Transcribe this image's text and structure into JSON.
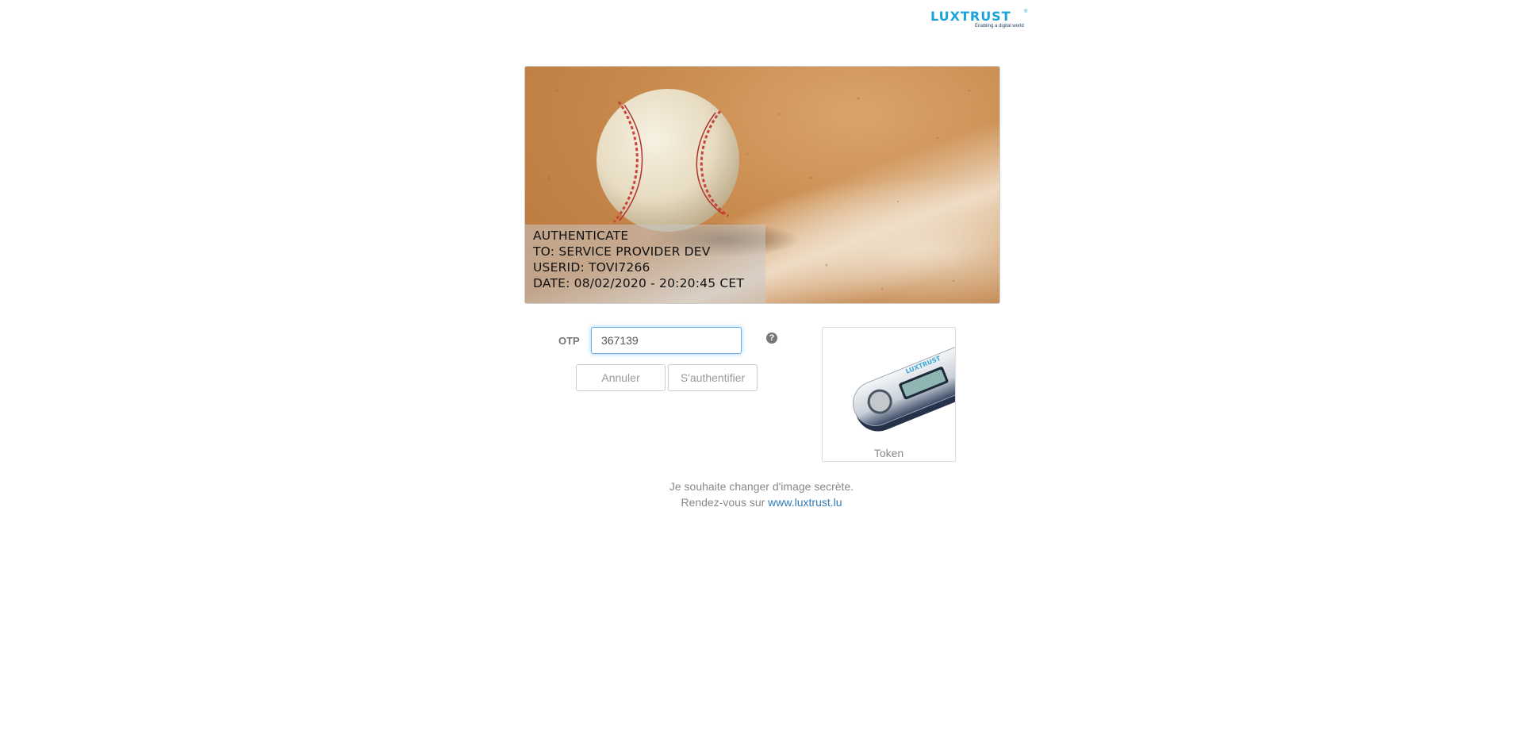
{
  "logo": {
    "brand": "LUXTRUST",
    "registered": "®",
    "tagline": "Enabling a digital world"
  },
  "secret_image": {
    "subject": "baseball on infield dirt",
    "lines": [
      "AUTHENTICATE",
      "TO: SERVICE PROVIDER DEV",
      "USERID: TOVI7266",
      "DATE: 08/02/2020 - 20:20:45 CET"
    ]
  },
  "form": {
    "otp_label": "OTP",
    "otp_value": "367139",
    "help_icon": "question-circle-icon",
    "cancel_label": "Annuler",
    "authenticate_label": "S'authentifier"
  },
  "token": {
    "label": "Token",
    "device_brand": "LUXTRUST"
  },
  "footer": {
    "line1": "Je souhaite changer d'image secrète.",
    "line2_prefix": "Rendez-vous sur",
    "link_text": "www.luxtrust.lu"
  },
  "colors": {
    "brand_blue": "#1aa3d9",
    "link_blue": "#337ab7",
    "focus_blue": "#66afe9"
  }
}
